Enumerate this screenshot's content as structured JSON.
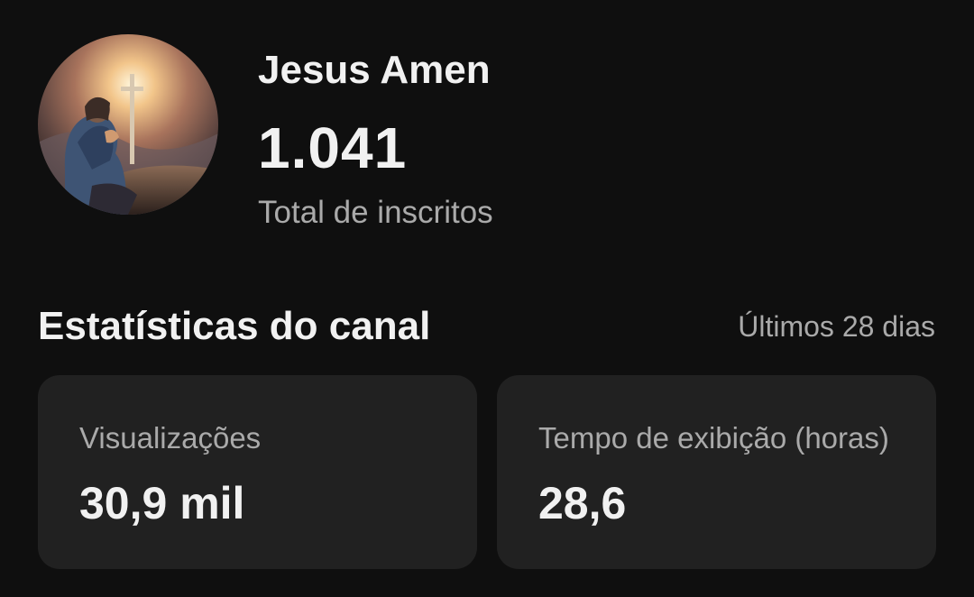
{
  "channel": {
    "avatar_icon": "praying-figure-with-cross-avatar",
    "name": "Jesus Amen",
    "subscriber_count": "1.041",
    "subscriber_label": "Total de inscritos"
  },
  "stats": {
    "title": "Estatísticas do canal",
    "period": "Últimos 28 dias",
    "cards": [
      {
        "label": "Visualizações",
        "value": "30,9 mil"
      },
      {
        "label": "Tempo de exibição (horas)",
        "value": "28,6"
      }
    ]
  },
  "colors": {
    "background": "#0f0f0f",
    "card": "#212121",
    "primary_text": "#f1f1f1",
    "secondary_text": "#aaaaaa"
  }
}
